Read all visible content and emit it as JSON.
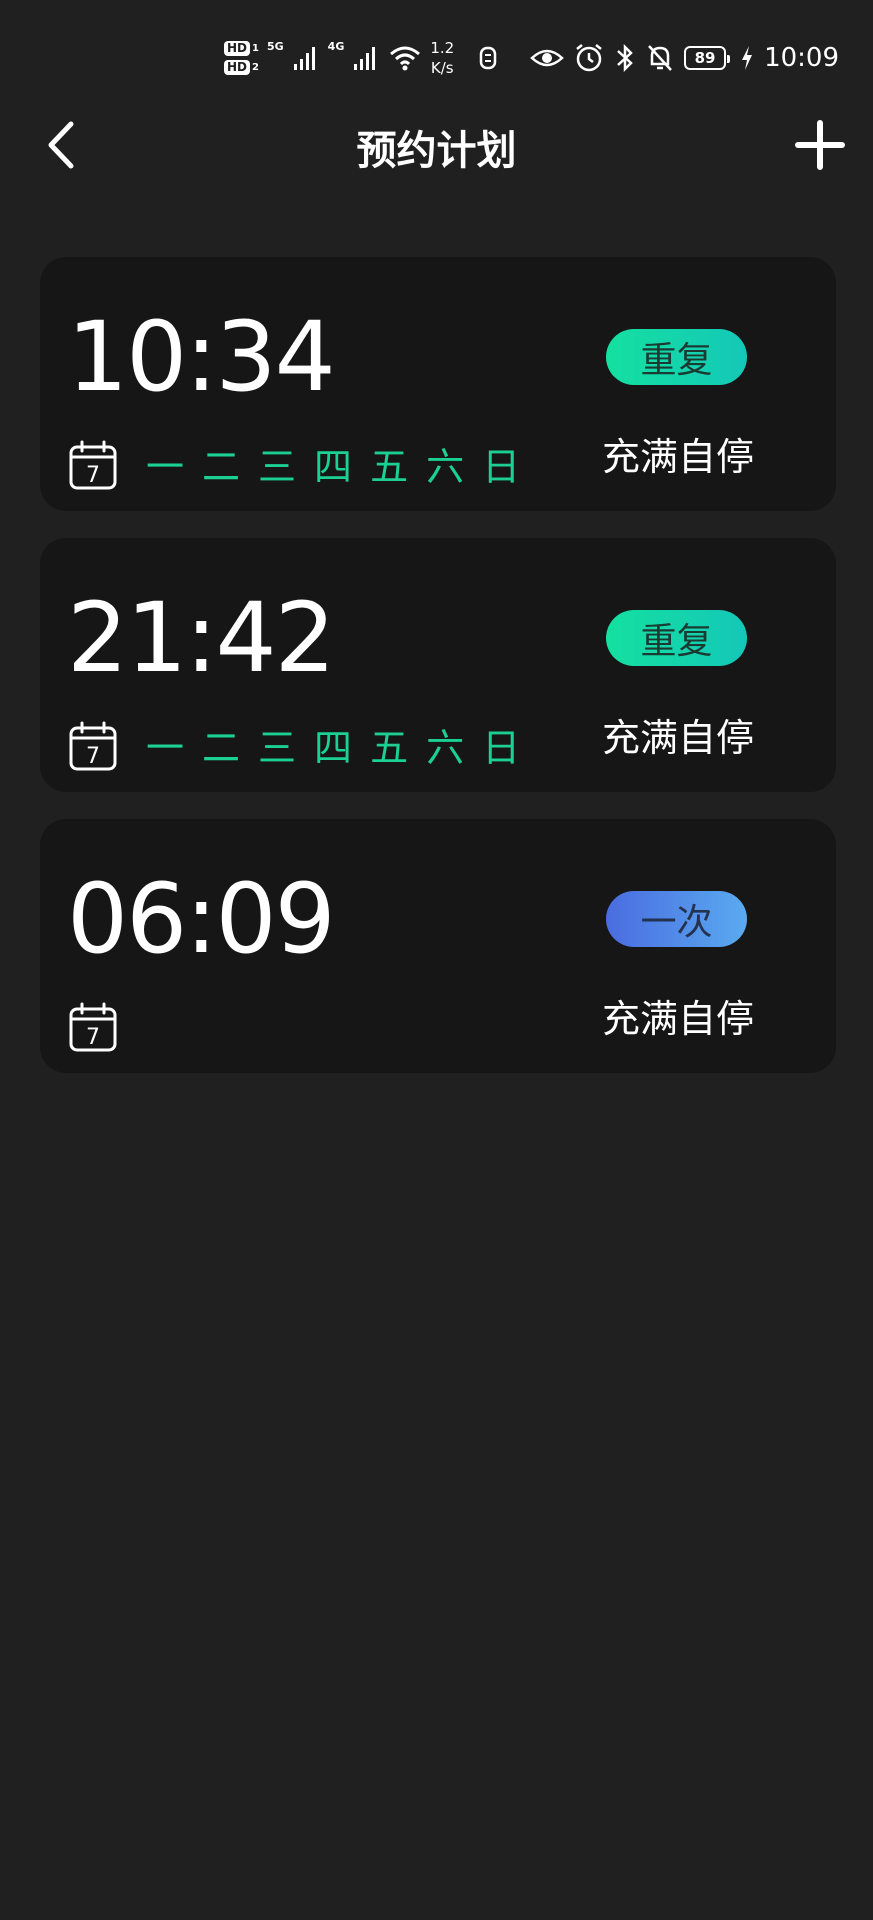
{
  "status_bar": {
    "sim1": "HD",
    "sim1_num": "1",
    "sim2": "HD",
    "sim2_num": "2",
    "net1": "5G",
    "net2": "4G",
    "speed_value": "1.2",
    "speed_unit": "K/s",
    "battery": "89",
    "time": "10:09"
  },
  "header": {
    "title": "预约计划"
  },
  "schedules": [
    {
      "time": "10:34",
      "type": "重复",
      "type_style": "repeat",
      "days": [
        "一",
        "二",
        "三",
        "四",
        "五",
        "六",
        "日"
      ],
      "calendar_day": "7",
      "mode": "充满自停"
    },
    {
      "time": "21:42",
      "type": "重复",
      "type_style": "repeat",
      "days": [
        "一",
        "二",
        "三",
        "四",
        "五",
        "六",
        "日"
      ],
      "calendar_day": "7",
      "mode": "充满自停"
    },
    {
      "time": "06:09",
      "type": "一次",
      "type_style": "once",
      "days": [],
      "calendar_day": "7",
      "mode": "充满自停"
    }
  ],
  "colors": {
    "background": "#202020",
    "card": "#161616",
    "accent_green": "#1ccf93",
    "repeat_badge": "#14d8a8",
    "once_badge": "#5080e0"
  }
}
